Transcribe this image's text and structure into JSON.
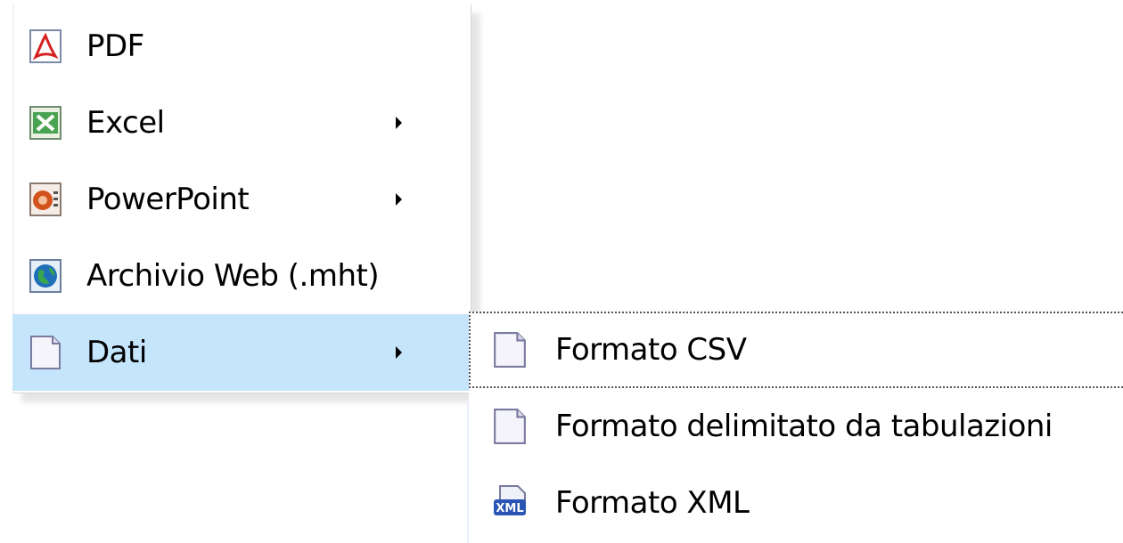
{
  "menu": {
    "items": [
      {
        "label": "PDF",
        "icon": "pdf-icon",
        "has_submenu": false,
        "selected": false
      },
      {
        "label": "Excel",
        "icon": "excel-icon",
        "has_submenu": true,
        "selected": false
      },
      {
        "label": "PowerPoint",
        "icon": "powerpoint-icon",
        "has_submenu": true,
        "selected": false
      },
      {
        "label": "Archivio Web (.mht)",
        "icon": "web-archive-icon",
        "has_submenu": false,
        "selected": false
      },
      {
        "label": "Dati",
        "icon": "data-document-icon",
        "has_submenu": true,
        "selected": true
      }
    ]
  },
  "submenu": {
    "items": [
      {
        "label": "Formato CSV",
        "icon": "csv-document-icon",
        "focused": true
      },
      {
        "label": "Formato delimitato da tabulazioni",
        "icon": "tab-delimited-document-icon",
        "focused": false
      },
      {
        "label": "Formato XML",
        "icon": "xml-icon",
        "focused": false
      }
    ]
  },
  "colors": {
    "selected_background": "#c5e5fb",
    "pdf_red": "#d42020",
    "excel_green": "#2e8b3a",
    "powerpoint_orange": "#d2521b",
    "web_blue": "#1f6fb8",
    "xml_blue": "#2a55b5"
  }
}
